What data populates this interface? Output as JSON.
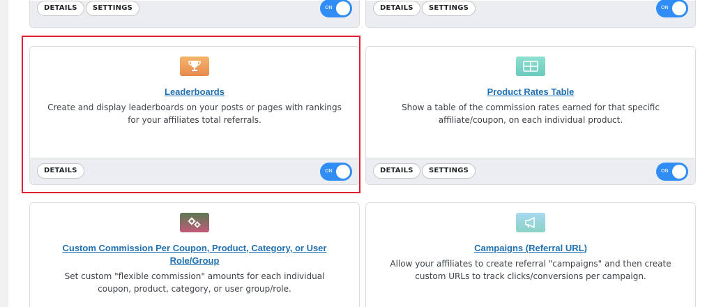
{
  "colors": {
    "link": "#2271b1",
    "toggle_on": "#2f8df5",
    "highlight": "#e02030"
  },
  "top_row": {
    "left": {
      "details_label": "DETAILS",
      "settings_label": "SETTINGS",
      "toggle_label": "ON"
    },
    "right": {
      "details_label": "DETAILS",
      "settings_label": "SETTINGS",
      "toggle_label": "ON"
    }
  },
  "cards": [
    {
      "icon": "trophy-icon",
      "title": "Leaderboards",
      "description": "Create and display leaderboards on your posts or pages with rankings for your affiliates total referrals.",
      "details_label": "DETAILS",
      "toggle_label": "ON"
    },
    {
      "icon": "table-icon",
      "title": "Product Rates Table",
      "description": "Show a table of the commission rates earned for that specific affiliate/coupon, on each individual product.",
      "details_label": "DETAILS",
      "settings_label": "SETTINGS",
      "toggle_label": "ON"
    },
    {
      "icon": "gears-icon",
      "title": "Custom Commission Per Coupon, Product, Category, or User Role/Group",
      "description": "Set custom \"flexible commission\" amounts for each individual coupon, product, category, or user group/role."
    },
    {
      "icon": "megaphone-icon",
      "title": "Campaigns (Referral URL)",
      "description": "Allow your affiliates to create referral \"campaigns\" and then create custom URLs to track clicks/conversions per campaign."
    }
  ]
}
